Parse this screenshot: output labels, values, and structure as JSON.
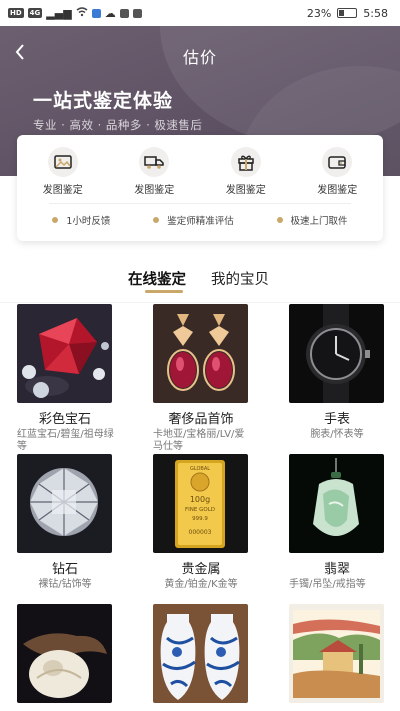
{
  "status_bar": {
    "left_labels": [
      "HD",
      "4G"
    ],
    "battery": "23%",
    "time": "5:58"
  },
  "nav": {
    "title": "估价"
  },
  "hero": {
    "headline": "一站式鉴定体验",
    "subtitle": "专业 · 高效 · 品种多 · 极速售后"
  },
  "services": [
    {
      "label": "发图鉴定",
      "icon": "image-icon"
    },
    {
      "label": "发图鉴定",
      "icon": "truck-icon"
    },
    {
      "label": "发图鉴定",
      "icon": "gift-icon"
    },
    {
      "label": "发图鉴定",
      "icon": "wallet-icon"
    }
  ],
  "features": [
    {
      "label": "1小时反馈"
    },
    {
      "label": "鉴定师精准评估"
    },
    {
      "label": "极速上门取件"
    }
  ],
  "tabs": [
    {
      "label": "在线鉴定",
      "active": true
    },
    {
      "label": "我的宝贝",
      "active": false
    }
  ],
  "accent": "#c9a86a",
  "categories": [
    {
      "title": "彩色宝石",
      "desc": "红蓝宝石/碧玺/祖母绿等",
      "image": "ruby-gems"
    },
    {
      "title": "奢侈品首饰",
      "desc": "卡地亚/宝格丽/LV/爱马仕等",
      "image": "earrings"
    },
    {
      "title": "手表",
      "desc": "腕表/怀表等",
      "image": "watch"
    },
    {
      "title": "钻石",
      "desc": "裸钻/钻饰等",
      "image": "diamond"
    },
    {
      "title": "贵金属",
      "desc": "黄金/铂金/K金等",
      "image": "gold-bar"
    },
    {
      "title": "翡翠",
      "desc": "手镯/吊坠/戒指等",
      "image": "jade-pendant"
    },
    {
      "title": "",
      "desc": "",
      "image": "jade-carving"
    },
    {
      "title": "",
      "desc": "",
      "image": "porcelain-vases"
    },
    {
      "title": "",
      "desc": "",
      "image": "painting"
    }
  ],
  "gold_bar_text": [
    "GLOBAL",
    "100g",
    "FINE GOLD",
    "999.9",
    "000003"
  ]
}
